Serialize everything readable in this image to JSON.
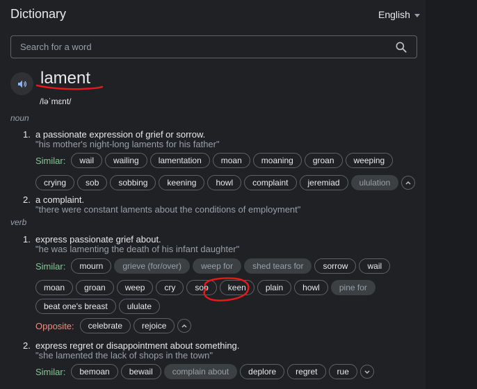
{
  "header": {
    "title": "Dictionary",
    "language": "English"
  },
  "search": {
    "placeholder": "Search for a word"
  },
  "entry": {
    "word": "lament",
    "pronunciation": "/ləˈmɛnt/",
    "noun": {
      "pos": "noun",
      "senses": [
        {
          "num": "1.",
          "definition": "a passionate expression of grief or sorrow.",
          "example": "\"his mother's night-long laments for his father\"",
          "similar_label": "Similar:",
          "similar_row1": [
            "wail",
            "wailing",
            "lamentation",
            "moan",
            "moaning",
            "groan",
            "weeping"
          ],
          "similar_row2": [
            "crying",
            "sob",
            "sobbing",
            "keening",
            "howl",
            "complaint",
            "jeremiad",
            "ululation"
          ]
        },
        {
          "num": "2.",
          "definition": "a complaint.",
          "example": "\"there were constant laments about the conditions of employment\""
        }
      ]
    },
    "verb": {
      "pos": "verb",
      "senses": [
        {
          "num": "1.",
          "definition": "express passionate grief about.",
          "example": "\"he was lamenting the death of his infant daughter\"",
          "similar_label": "Similar:",
          "similar_row1": [
            "mourn",
            "grieve (for/over)",
            "weep for",
            "shed tears for",
            "sorrow",
            "wail"
          ],
          "similar_row2": [
            "moan",
            "groan",
            "weep",
            "cry",
            "sob",
            "keen",
            "plain",
            "howl",
            "pine for"
          ],
          "similar_row3": [
            "beat one's breast",
            "ululate"
          ],
          "opposite_label": "Opposite:",
          "opposite": [
            "celebrate",
            "rejoice"
          ]
        },
        {
          "num": "2.",
          "definition": "express regret or disappointment about something.",
          "example": "\"she lamented the lack of shops in the town\"",
          "similar_label": "Similar:",
          "similar_row1": [
            "bemoan",
            "bewail",
            "complain about",
            "deplore",
            "regret",
            "rue"
          ]
        }
      ]
    }
  },
  "colors": {
    "background": "#202124",
    "similar": "#81c995",
    "opposite": "#f28b82",
    "annotation": "#e21b1b"
  },
  "icons": {
    "search": "search-icon",
    "speaker": "speaker-icon",
    "expand": "chevron-icon"
  }
}
